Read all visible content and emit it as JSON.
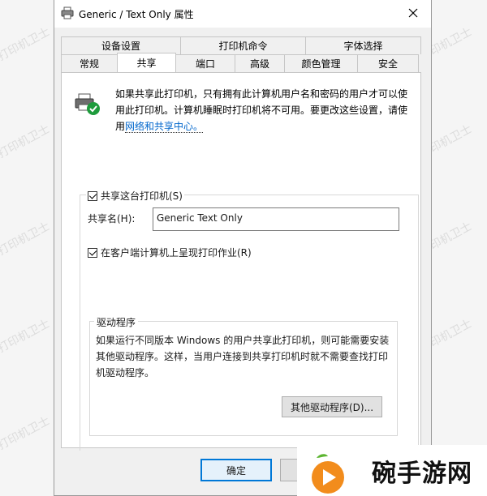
{
  "window": {
    "title": "Generic / Text Only 属性"
  },
  "tabs": {
    "back_row": [
      "设备设置",
      "打印机命令",
      "字体选择"
    ],
    "front_row": [
      "常规",
      "共享",
      "端口",
      "高级",
      "颜色管理",
      "安全"
    ],
    "selected": "共享"
  },
  "info": {
    "text": "如果共享此打印机，只有拥有此计算机用户名和密码的用户才可以使用此打印机。计算机睡眠时打印机将不可用。要更改这些设置，请使用",
    "link": "网络和共享中心。"
  },
  "share": {
    "checkbox_label": "共享这台打印机(S)",
    "checked": true,
    "name_label": "共享名(H):",
    "name_value": "Generic  Text Only",
    "render_label": "在客户端计算机上呈现打印作业(R)",
    "render_checked": true
  },
  "driver": {
    "legend": "驱动程序",
    "text": "如果运行不同版本 Windows 的用户共享此打印机，则可能需要安装其他驱动程序。这样，当用户连接到共享打印机时就不需要查找打印机驱动程序。",
    "button": "其他驱动程序(D)..."
  },
  "buttons": {
    "ok": "确定"
  },
  "watermark": "打印机卫士",
  "brand": {
    "name": "碗手游网"
  },
  "colors": {
    "accent": "#0078d7",
    "link": "#0066cc",
    "brand_orange": "#f28c1c",
    "brand_green": "#5cb531"
  }
}
